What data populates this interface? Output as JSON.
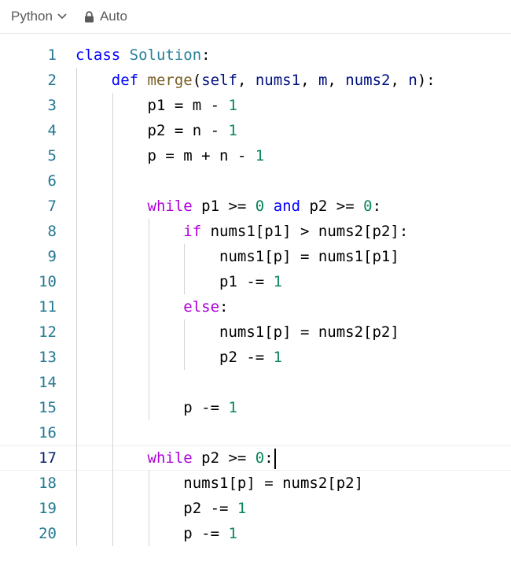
{
  "toolbar": {
    "language": "Python",
    "mode": "Auto"
  },
  "editor": {
    "current_line": 17,
    "lines": [
      {
        "n": "1",
        "indent": 0,
        "tokens": [
          {
            "t": "class",
            "c": "kw"
          },
          {
            "t": " ",
            "c": ""
          },
          {
            "t": "Solution",
            "c": "cls"
          },
          {
            "t": ":",
            "c": ""
          }
        ]
      },
      {
        "n": "2",
        "indent": 1,
        "tokens": [
          {
            "t": "def",
            "c": "kw"
          },
          {
            "t": " ",
            "c": ""
          },
          {
            "t": "merge",
            "c": "fn"
          },
          {
            "t": "(",
            "c": ""
          },
          {
            "t": "self",
            "c": "param"
          },
          {
            "t": ", ",
            "c": ""
          },
          {
            "t": "nums1",
            "c": "param"
          },
          {
            "t": ", ",
            "c": ""
          },
          {
            "t": "m",
            "c": "param"
          },
          {
            "t": ", ",
            "c": ""
          },
          {
            "t": "nums2",
            "c": "param"
          },
          {
            "t": ", ",
            "c": ""
          },
          {
            "t": "n",
            "c": "param"
          },
          {
            "t": "):",
            "c": ""
          }
        ]
      },
      {
        "n": "3",
        "indent": 2,
        "tokens": [
          {
            "t": "p1 = m - ",
            "c": ""
          },
          {
            "t": "1",
            "c": "num"
          }
        ]
      },
      {
        "n": "4",
        "indent": 2,
        "tokens": [
          {
            "t": "p2 = n - ",
            "c": ""
          },
          {
            "t": "1",
            "c": "num"
          }
        ]
      },
      {
        "n": "5",
        "indent": 2,
        "tokens": [
          {
            "t": "p = m + n - ",
            "c": ""
          },
          {
            "t": "1",
            "c": "num"
          }
        ]
      },
      {
        "n": "6",
        "indent": 2,
        "tokens": []
      },
      {
        "n": "7",
        "indent": 2,
        "tokens": [
          {
            "t": "while",
            "c": "ctrl"
          },
          {
            "t": " p1 >= ",
            "c": ""
          },
          {
            "t": "0",
            "c": "num"
          },
          {
            "t": " ",
            "c": ""
          },
          {
            "t": "and",
            "c": "kw"
          },
          {
            "t": " p2 >= ",
            "c": ""
          },
          {
            "t": "0",
            "c": "num"
          },
          {
            "t": ":",
            "c": ""
          }
        ]
      },
      {
        "n": "8",
        "indent": 3,
        "tokens": [
          {
            "t": "if",
            "c": "ctrl"
          },
          {
            "t": " nums1[p1] > nums2[p2]:",
            "c": ""
          }
        ]
      },
      {
        "n": "9",
        "indent": 4,
        "tokens": [
          {
            "t": "nums1[p] = nums1[p1]",
            "c": ""
          }
        ]
      },
      {
        "n": "10",
        "indent": 4,
        "tokens": [
          {
            "t": "p1 -= ",
            "c": ""
          },
          {
            "t": "1",
            "c": "num"
          }
        ]
      },
      {
        "n": "11",
        "indent": 3,
        "tokens": [
          {
            "t": "else",
            "c": "ctrl"
          },
          {
            "t": ":",
            "c": ""
          }
        ]
      },
      {
        "n": "12",
        "indent": 4,
        "tokens": [
          {
            "t": "nums1[p] = nums2[p2]",
            "c": ""
          }
        ]
      },
      {
        "n": "13",
        "indent": 4,
        "tokens": [
          {
            "t": "p2 -= ",
            "c": ""
          },
          {
            "t": "1",
            "c": "num"
          }
        ]
      },
      {
        "n": "14",
        "indent": 3,
        "tokens": []
      },
      {
        "n": "15",
        "indent": 3,
        "tokens": [
          {
            "t": "p -= ",
            "c": ""
          },
          {
            "t": "1",
            "c": "num"
          }
        ]
      },
      {
        "n": "16",
        "indent": 2,
        "tokens": []
      },
      {
        "n": "17",
        "indent": 2,
        "tokens": [
          {
            "t": "while",
            "c": "ctrl"
          },
          {
            "t": " p2 >= ",
            "c": ""
          },
          {
            "t": "0",
            "c": "num"
          },
          {
            "t": ":",
            "c": ""
          }
        ]
      },
      {
        "n": "18",
        "indent": 3,
        "tokens": [
          {
            "t": "nums1[p] = nums2[p2]",
            "c": ""
          }
        ]
      },
      {
        "n": "19",
        "indent": 3,
        "tokens": [
          {
            "t": "p2 -= ",
            "c": ""
          },
          {
            "t": "1",
            "c": "num"
          }
        ]
      },
      {
        "n": "20",
        "indent": 3,
        "tokens": [
          {
            "t": "p -= ",
            "c": ""
          },
          {
            "t": "1",
            "c": "num"
          }
        ]
      }
    ]
  }
}
